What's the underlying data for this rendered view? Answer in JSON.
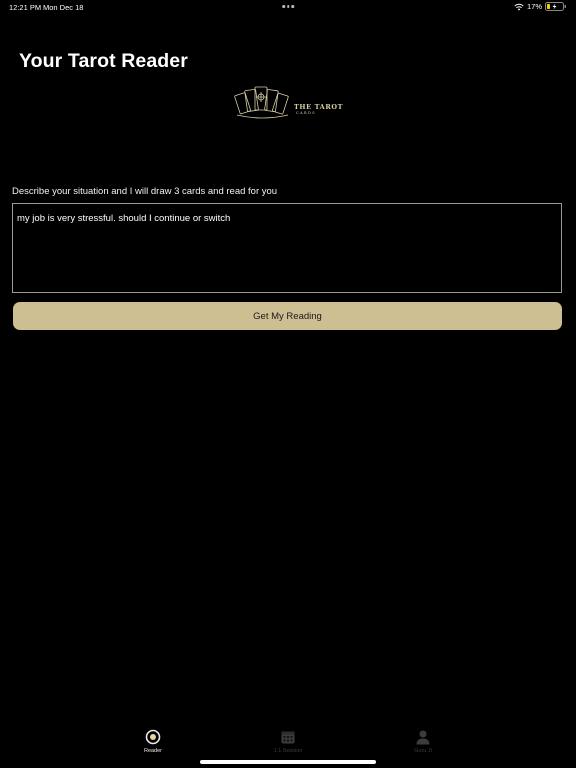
{
  "status_bar": {
    "time": "12:21 PM",
    "date": "Mon Dec 18",
    "battery": "17%"
  },
  "header": {
    "title": "Your Tarot Reader"
  },
  "logo": {
    "name": "THE TAROT",
    "sub": "CARDS"
  },
  "form": {
    "prompt": "Describe your situation and I will draw 3 cards and read for you",
    "situation_value": "my job is very stressful. should I continue or switch",
    "submit_label": "Get My Reading"
  },
  "tabs": [
    {
      "label": "Reader",
      "icon": "reader-icon",
      "active": true
    },
    {
      "label": "1:1 Session",
      "icon": "calendar-icon",
      "active": false
    },
    {
      "label": "Guru Ji",
      "icon": "person-icon",
      "active": false
    }
  ],
  "colors": {
    "background": "#000000",
    "accent": "#cdbf92",
    "text": "#ffffff",
    "inactive_tab": "#3c3c3c"
  }
}
